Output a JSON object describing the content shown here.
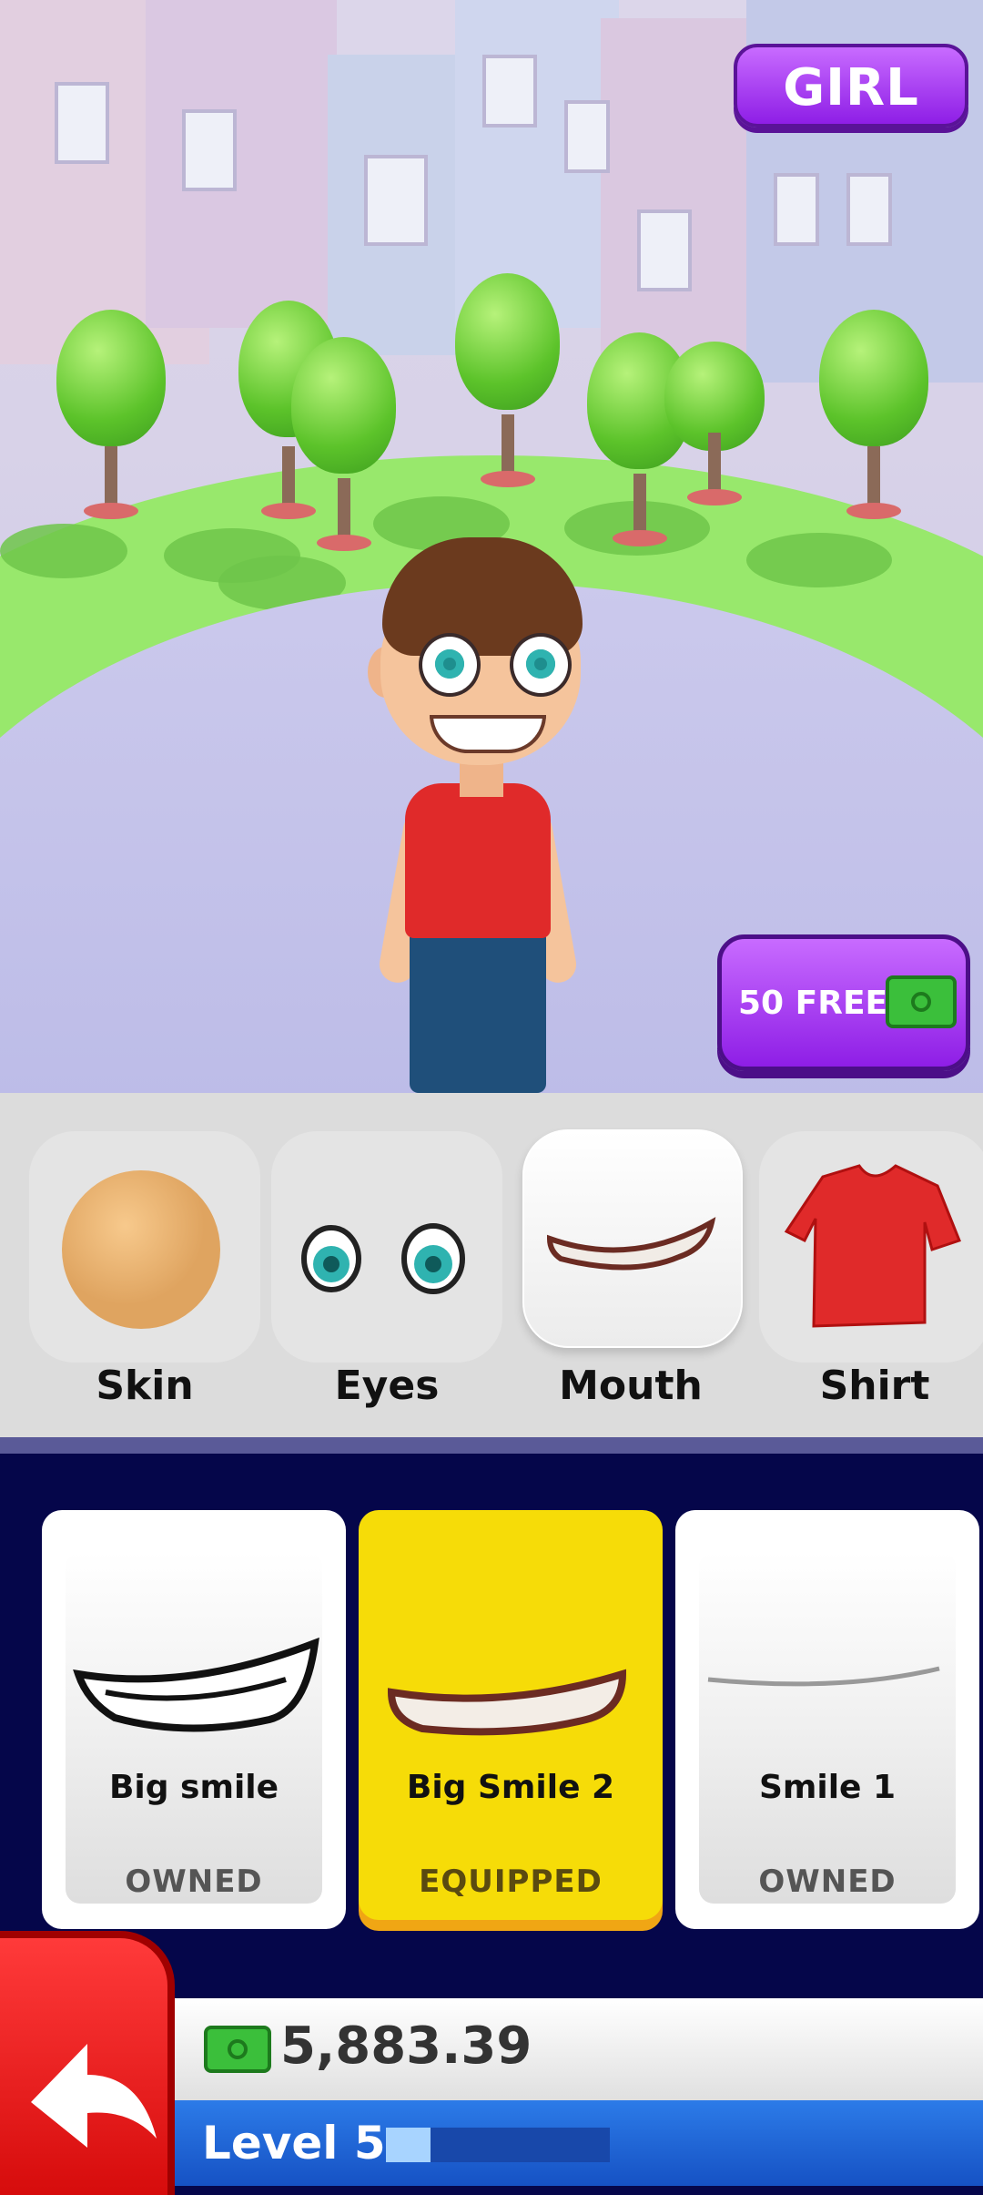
{
  "header": {
    "gender_button_label": "GIRL",
    "free_offer_label": "50 FREE",
    "free_offer_icon": "cash-icon"
  },
  "categories": [
    {
      "label": "Skin",
      "icon": "skin-tone-icon",
      "active": false
    },
    {
      "label": "Eyes",
      "icon": "eyes-icon",
      "active": false
    },
    {
      "label": "Mouth",
      "icon": "mouth-icon",
      "active": true
    },
    {
      "label": "Shirt",
      "icon": "shirt-icon",
      "active": false
    }
  ],
  "items": [
    {
      "name": "Big smile",
      "status": "OWNED",
      "icon": "big-smile-icon"
    },
    {
      "name": "Big Smile 2",
      "status": "EQUIPPED",
      "icon": "big-smile-2-icon"
    },
    {
      "name": "Smile 1",
      "status": "OWNED",
      "icon": "smile-1-icon"
    }
  ],
  "footer": {
    "back_icon": "back-arrow-icon",
    "money": "5,883.39",
    "money_icon": "cash-icon",
    "level_label": "Level 5",
    "level_progress": 0.2
  },
  "colors": {
    "accent_purple": "#9b2cf0",
    "equipped_yellow": "#f6dc08",
    "back_red": "#e01818",
    "level_blue": "#1f66d8",
    "panel_navy": "#05064a"
  }
}
